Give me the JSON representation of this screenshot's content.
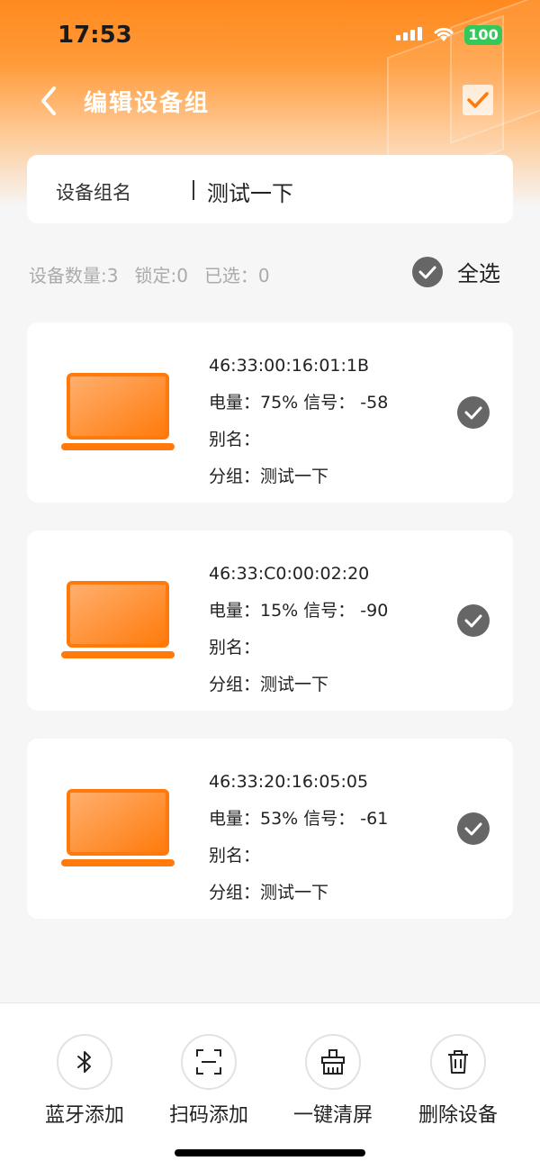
{
  "status": {
    "time": "17:53",
    "battery": "100"
  },
  "nav": {
    "title": "编辑设备组"
  },
  "group": {
    "label": "设备组名",
    "value": "测试一下"
  },
  "summary": {
    "count": "设备数量:3",
    "locked": "锁定:0",
    "selected": "已选：0",
    "select_all": "全选"
  },
  "devices": [
    {
      "mac": "46:33:00:16:01:1B",
      "stats": "电量：75% 信号： -58",
      "alias": "别名：",
      "group": "分组：测试一下"
    },
    {
      "mac": "46:33:C0:00:02:20",
      "stats": "电量：15% 信号： -90",
      "alias": "别名：",
      "group": "分组：测试一下"
    },
    {
      "mac": "46:33:20:16:05:05",
      "stats": "电量：53% 信号： -61",
      "alias": "别名：",
      "group": "分组：测试一下"
    }
  ],
  "actions": [
    {
      "label": "蓝牙添加",
      "icon": "bluetooth-icon"
    },
    {
      "label": "扫码添加",
      "icon": "scan-icon"
    },
    {
      "label": "一键清屏",
      "icon": "clear-screen-icon"
    },
    {
      "label": "删除设备",
      "icon": "trash-icon"
    }
  ],
  "colors": {
    "accent": "#ff7a0a",
    "check_bg": "#666666"
  }
}
